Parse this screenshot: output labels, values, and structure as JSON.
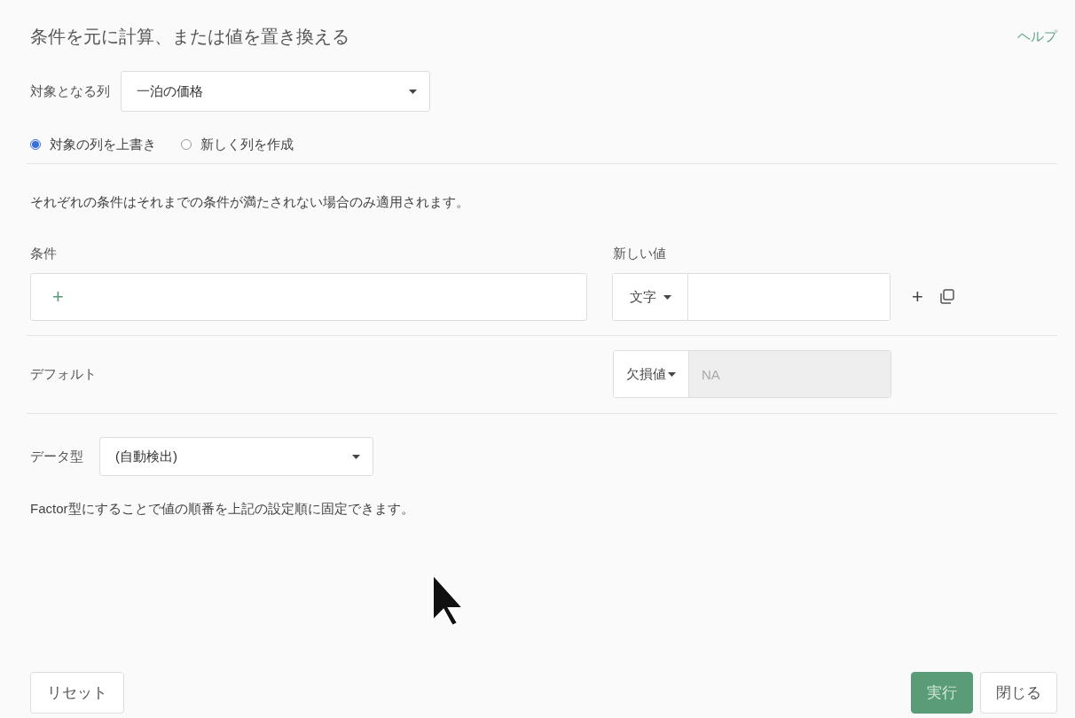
{
  "dialog": {
    "title": "条件を元に計算、または値を置き換える",
    "help_link": "ヘルプ"
  },
  "target_column": {
    "label": "対象となる列",
    "value": "一泊の価格"
  },
  "output_mode": [
    {
      "label": "対象の列を上書き",
      "selected": true
    },
    {
      "label": "新しく列を作成",
      "selected": false
    }
  ],
  "note": "それぞれの条件はそれまでの条件が満たされない場合のみ適用されます。",
  "conditions": {
    "condition_header": "条件",
    "value_header": "新しい値",
    "add_symbol": "+",
    "rows": [
      {
        "value_type": "文字"
      }
    ]
  },
  "default": {
    "label": "デフォルト",
    "value_type": "欠損値",
    "value": "NA",
    "disabled": true
  },
  "data_type": {
    "label": "データ型",
    "value": "(自動検出)"
  },
  "data_type_note": "Factor型にすることで値の順番を上記の設定順に固定できます。",
  "reset_button": "リセット",
  "action_buttons": [
    {
      "label": "実行",
      "kind": "primary"
    },
    {
      "label": "閉じる",
      "kind": "default"
    }
  ]
}
